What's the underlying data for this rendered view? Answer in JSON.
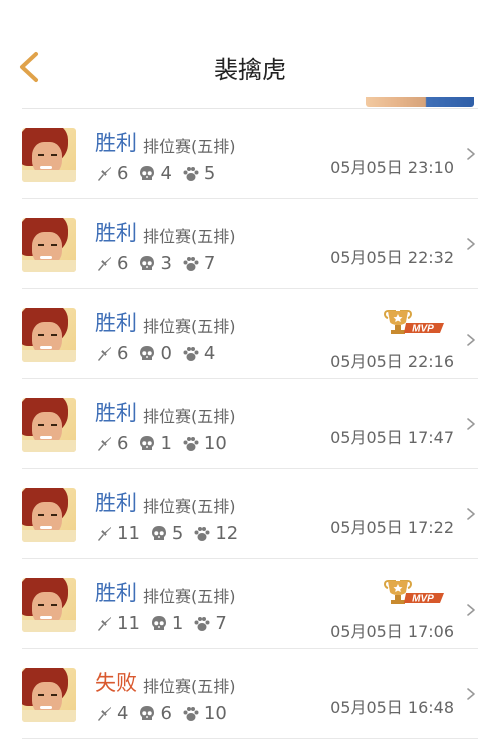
{
  "header": {
    "title": "裴擒虎"
  },
  "colors": {
    "win": "#3f6fb7",
    "lose": "#d9592f",
    "accent": "#e0a24a"
  },
  "matches": [
    {
      "result": "胜利",
      "type": "win",
      "mode": "排位赛(五排)",
      "kills": "6",
      "deaths": "4",
      "assists": "5",
      "time": "05月05日 23:10",
      "mvp": false
    },
    {
      "result": "胜利",
      "type": "win",
      "mode": "排位赛(五排)",
      "kills": "6",
      "deaths": "3",
      "assists": "7",
      "time": "05月05日 22:32",
      "mvp": false
    },
    {
      "result": "胜利",
      "type": "win",
      "mode": "排位赛(五排)",
      "kills": "6",
      "deaths": "0",
      "assists": "4",
      "time": "05月05日 22:16",
      "mvp": true,
      "mvp_label": "MVP"
    },
    {
      "result": "胜利",
      "type": "win",
      "mode": "排位赛(五排)",
      "kills": "6",
      "deaths": "1",
      "assists": "10",
      "time": "05月05日 17:47",
      "mvp": false
    },
    {
      "result": "胜利",
      "type": "win",
      "mode": "排位赛(五排)",
      "kills": "11",
      "deaths": "5",
      "assists": "12",
      "time": "05月05日 17:22",
      "mvp": false
    },
    {
      "result": "胜利",
      "type": "win",
      "mode": "排位赛(五排)",
      "kills": "11",
      "deaths": "1",
      "assists": "7",
      "time": "05月05日 17:06",
      "mvp": true,
      "mvp_label": "MVP"
    },
    {
      "result": "失败",
      "type": "lose",
      "mode": "排位赛(五排)",
      "kills": "4",
      "deaths": "6",
      "assists": "10",
      "time": "05月05日 16:48",
      "mvp": false
    }
  ]
}
